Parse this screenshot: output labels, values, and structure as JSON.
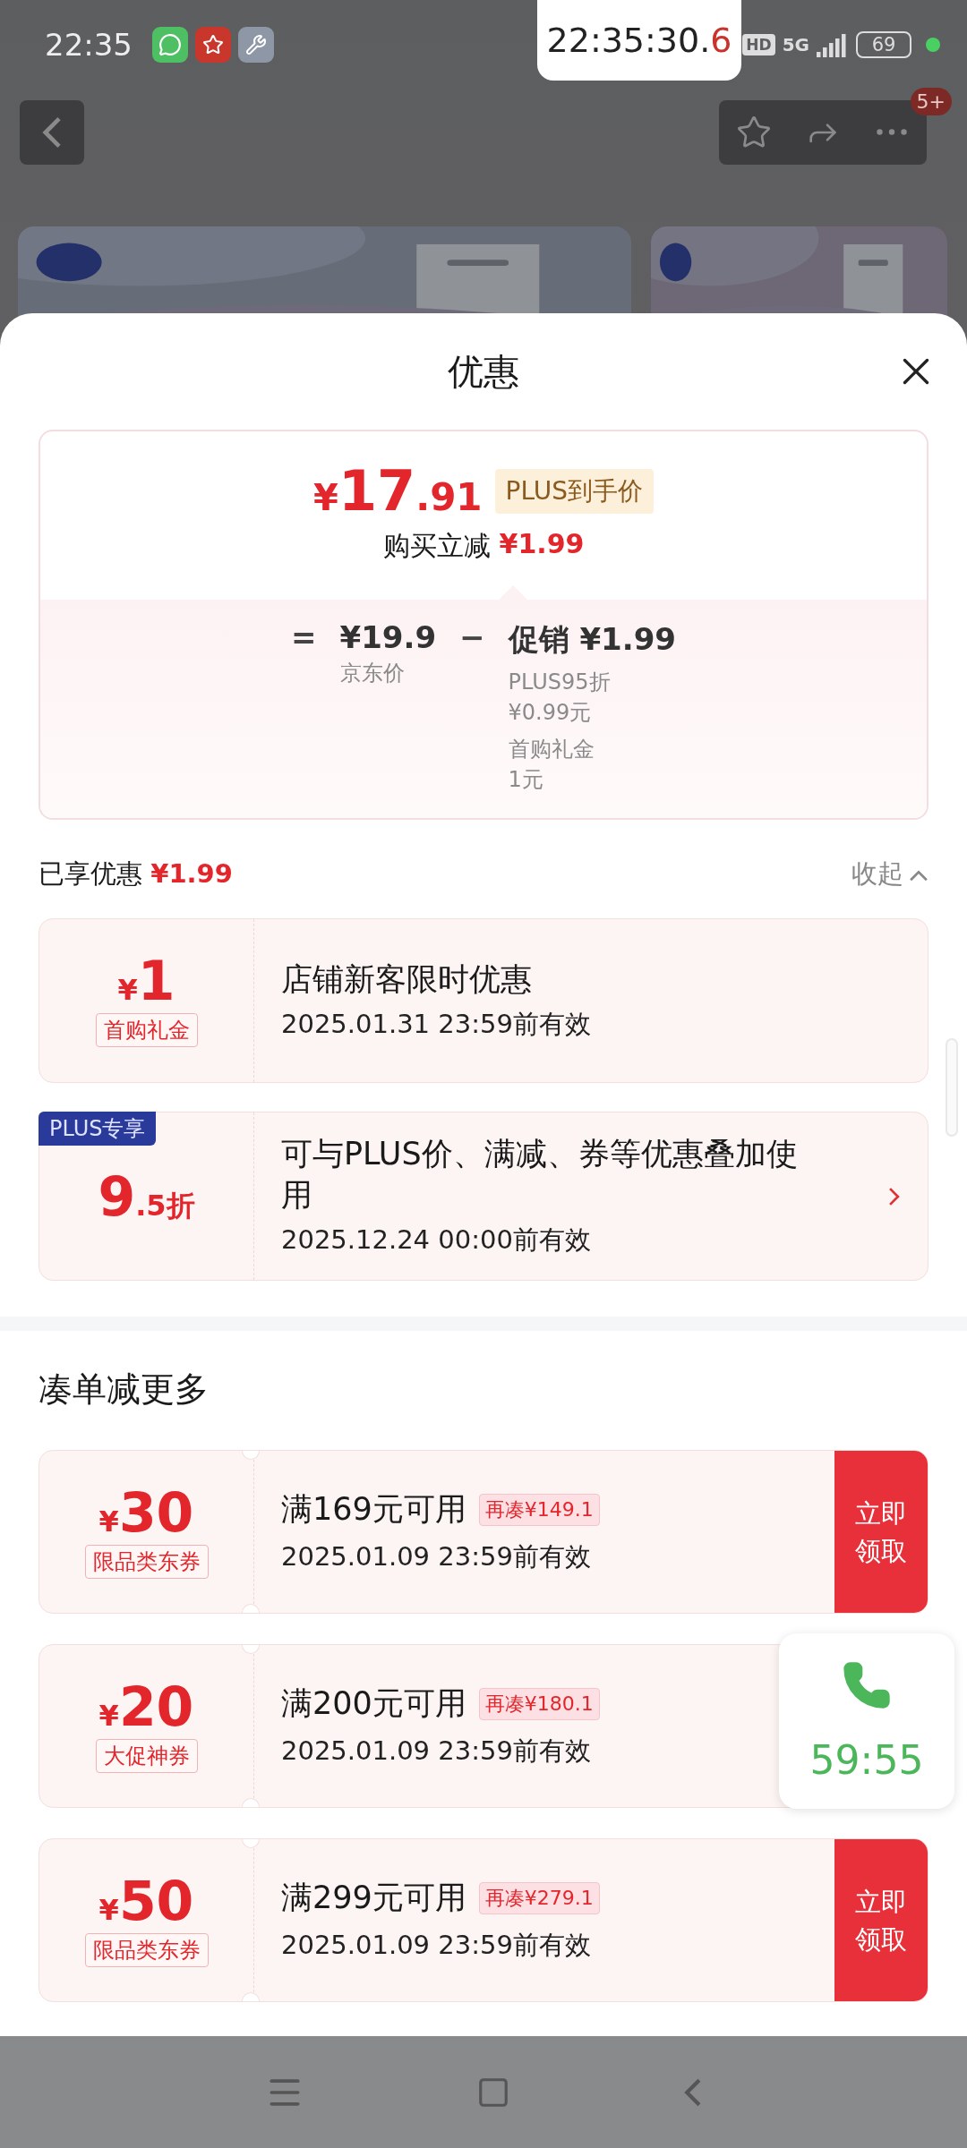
{
  "status_bar": {
    "time": "22:35",
    "hd": "HD",
    "network": "5G",
    "battery": "69"
  },
  "clock_overlay": {
    "main": "22:35:30.",
    "tenth": "6"
  },
  "page_header": {
    "badge": "5+"
  },
  "sheet": {
    "title": "优惠"
  },
  "price_card": {
    "price": {
      "currency": "¥",
      "whole": "17",
      "fraction": ".91"
    },
    "price_tag": "PLUS到手价",
    "reduce_label": "购买立减",
    "reduce_amount": "¥1.99",
    "equals": "=",
    "base_price": "¥19.9",
    "base_label": "京东价",
    "minus": "−",
    "promo_label": "促销",
    "promo_amount": "¥1.99",
    "promo_details": [
      {
        "name": "PLUS95折",
        "amount": "¥0.99元"
      },
      {
        "name": "首购礼金",
        "amount": "1元"
      }
    ]
  },
  "applied": {
    "label": "已享优惠",
    "amount": "¥1.99",
    "toggle": "收起",
    "expanded": true
  },
  "discounts": [
    {
      "kind": "amount",
      "currency": "¥",
      "value": "1",
      "tag": "首购礼金",
      "title": "店铺新客限时优惠",
      "validity": "2025.01.31 23:59前有效",
      "arrow": false
    },
    {
      "kind": "rate",
      "badge": "PLUS专享",
      "whole": "9",
      "fraction": ".5折",
      "title": "可与PLUS价、满减、券等优惠叠加使用",
      "validity": "2025.12.24 00:00前有效",
      "arrow": true
    }
  ],
  "more_section": {
    "title": "凑单减更多"
  },
  "coupons": [
    {
      "currency": "¥",
      "value": "30",
      "tag": "限品类东券",
      "condition": "满169元可用",
      "gap": "再凑¥149.1",
      "validity": "2025.01.09 23:59前有效",
      "claim": "立即领取"
    },
    {
      "currency": "¥",
      "value": "20",
      "tag": "大促神券",
      "condition": "满200元可用",
      "gap": "再凑¥180.1",
      "validity": "2025.01.09 23:59前有效"
    },
    {
      "currency": "¥",
      "value": "50",
      "tag": "限品类东券",
      "condition": "满299元可用",
      "gap": "再凑¥279.1",
      "validity": "2025.01.09 23:59前有效",
      "claim": "立即领取"
    }
  ],
  "call_widget": {
    "timer": "59:55"
  }
}
